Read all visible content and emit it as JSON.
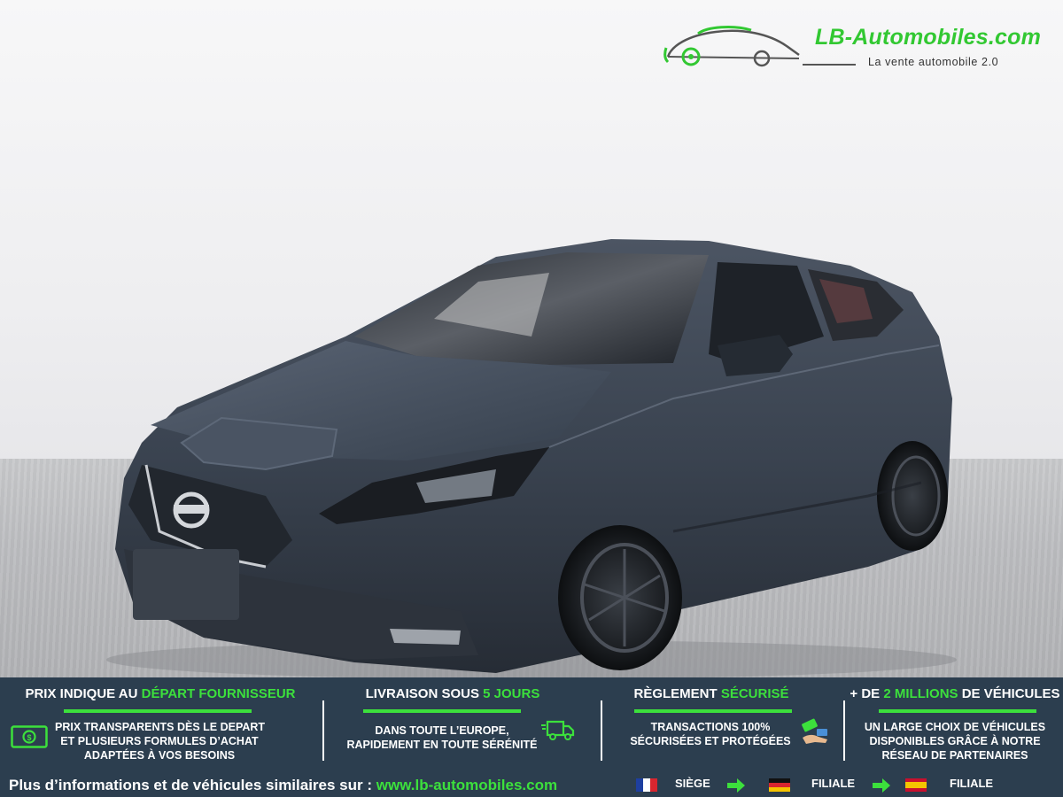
{
  "logo": {
    "brand": "LB-Automobiles.com",
    "tagline": "La vente automobile 2.0",
    "accent_color": "#32c832"
  },
  "banner": {
    "background": "#2c3e4f",
    "accent_color": "#3ce03c",
    "columns": [
      {
        "title_plain": "PRIX INDIQUE AU ",
        "title_green": "DÉPART FOURNISSEUR",
        "lines": [
          "PRIX TRANSPARENTS DÈS LE DEPART",
          "ET PLUSIEURS FORMULES D’ACHAT",
          "ADAPTÉES À VOS BESOINS"
        ],
        "icon": "cash-icon"
      },
      {
        "title_plain": "LIVRAISON SOUS ",
        "title_green": "5 JOURS",
        "lines": [
          "DANS TOUTE L’EUROPE,",
          "RAPIDEMENT EN TOUTE SÉRÉNITÉ"
        ],
        "icon": "delivery-truck-icon"
      },
      {
        "title_plain": "RÈGLEMENT ",
        "title_green": "SÉCURISÉ",
        "lines": [
          "TRANSACTIONS 100%",
          "SÉCURISÉES ET PROTÉGÉES"
        ],
        "icon": "payment-hand-icon"
      },
      {
        "title_plain": "+ DE ",
        "title_green": "2 MILLIONS",
        "title_suffix": " DE VÉHICULES",
        "lines": [
          "UN LARGE CHOIX DE VÉHICULES",
          "DISPONIBLES GRÂCE À NOTRE",
          "RÉSEAU DE PARTENAIRES"
        ]
      }
    ],
    "footer": {
      "text": "Plus d’informations et de véhicules similaires sur : ",
      "url": "www.lb-automobiles.com"
    },
    "locations": [
      {
        "flag": "france-flag-icon",
        "label": "SIÈGE"
      },
      {
        "flag": "germany-flag-icon",
        "label": "FILIALE"
      },
      {
        "flag": "spain-flag-icon",
        "label": "FILIALE"
      }
    ]
  },
  "photo": {
    "subject": "car-photo",
    "car_color": "#3d4654"
  }
}
